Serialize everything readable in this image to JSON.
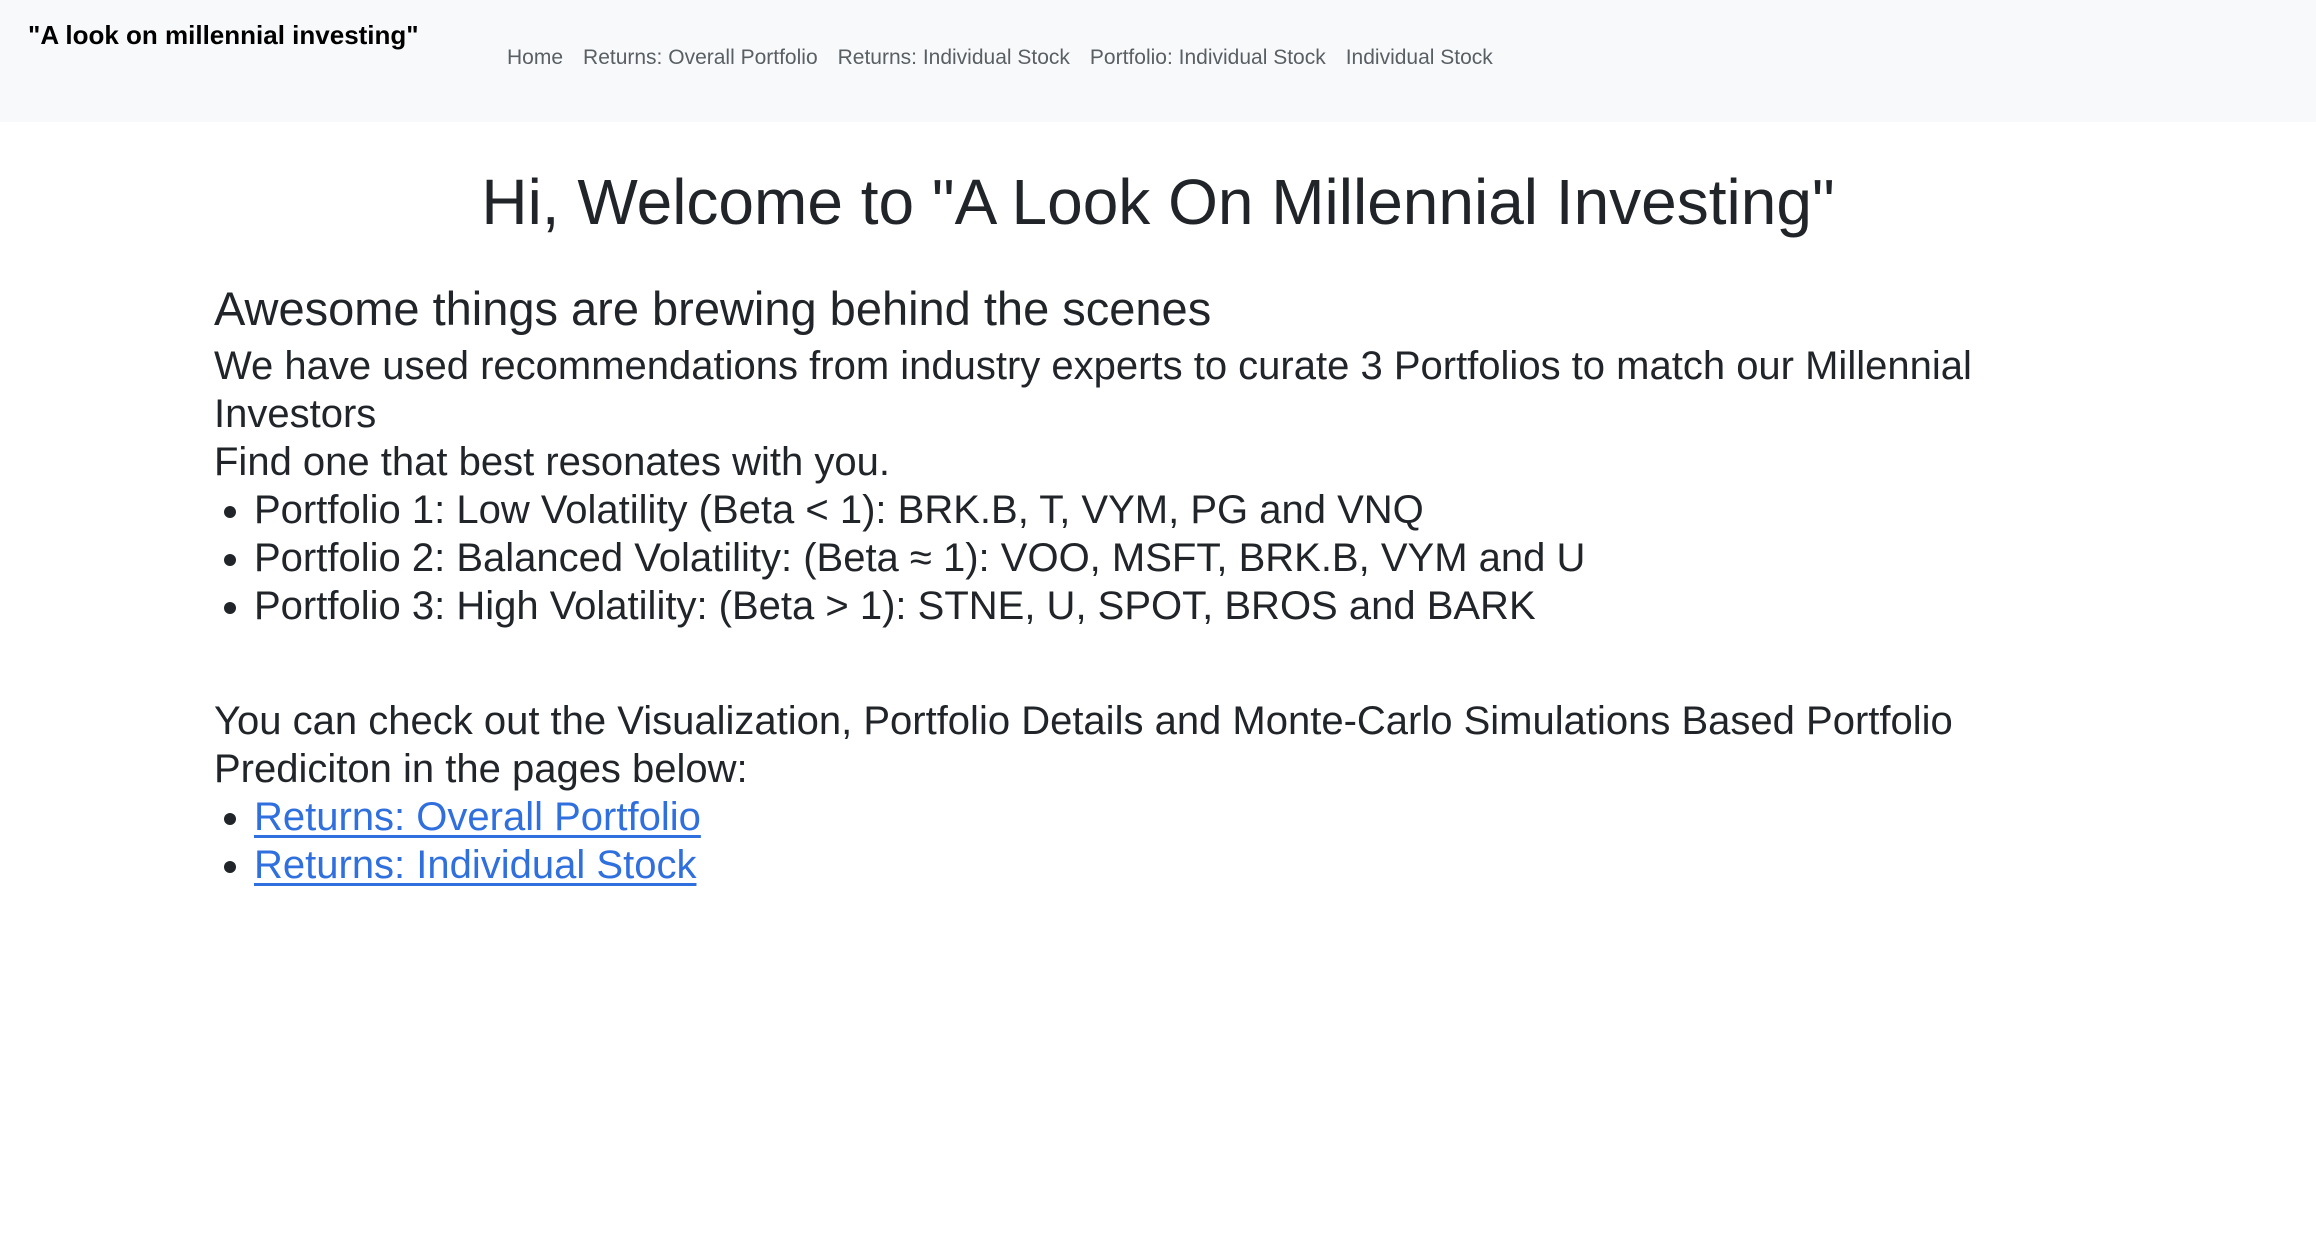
{
  "navbar": {
    "brand": "\"A look on millennial investing\"",
    "links": [
      {
        "label": "Home"
      },
      {
        "label": "Returns: Overall Portfolio"
      },
      {
        "label": "Returns: Individual Stock"
      },
      {
        "label": "Portfolio: Individual Stock"
      },
      {
        "label": "Individual Stock"
      }
    ]
  },
  "main": {
    "title": "Hi, Welcome to \"A Look On Millennial Investing\"",
    "subtitle": "Awesome things are brewing behind the scenes",
    "intro_line1": "We have used recommendations from industry experts to curate 3 Portfolios to match our Millennial Investors",
    "intro_line2": "Find one that best resonates with you.",
    "portfolios": [
      {
        "text": "Portfolio 1: Low Volatility (Beta < 1): BRK.B, T, VYM, PG and VNQ"
      },
      {
        "text": "Portfolio 2: Balanced Volatility: (Beta ≈ 1): VOO, MSFT, BRK.B, VYM and U"
      },
      {
        "text": "Portfolio 3: High Volatility: (Beta > 1): STNE, U, SPOT, BROS and BARK"
      }
    ],
    "outro": "You can check out the Visualization, Portfolio Details and Monte-Carlo Simulations Based Portfolio Prediciton in the pages below:",
    "page_links": [
      {
        "label": "Returns: Overall Portfolio"
      },
      {
        "label": "Returns: Individual Stock"
      }
    ]
  },
  "colors": {
    "navbar_bg": "#f8f9fa",
    "text": "#212529",
    "link": "#2f6fde",
    "nav_link": "#5a5f64"
  }
}
